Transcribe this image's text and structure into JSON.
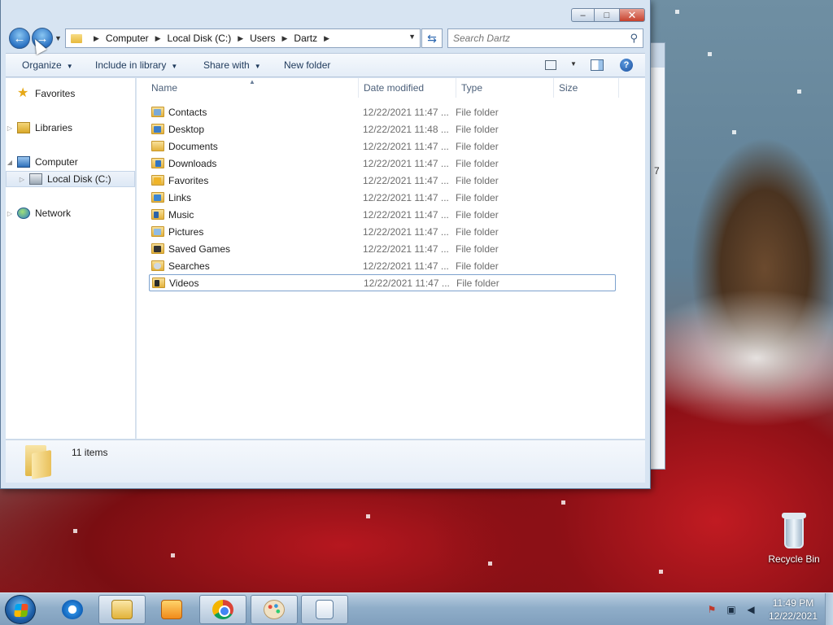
{
  "window": {
    "controls": {
      "minimize": "–",
      "maximize": "□",
      "close": "✕"
    }
  },
  "navigation": {
    "back_glyph": "←",
    "forward_glyph": "→",
    "breadcrumb": [
      "Computer",
      "Local Disk (C:)",
      "Users",
      "Dartz"
    ],
    "search_placeholder": "Search Dartz"
  },
  "command_bar": {
    "organize": "Organize",
    "include_in_library": "Include in library",
    "share_with": "Share with",
    "new_folder": "New folder",
    "help": "?"
  },
  "nav_pane": {
    "favorites": "Favorites",
    "libraries": "Libraries",
    "computer": "Computer",
    "local_disk": "Local Disk (C:)",
    "network": "Network"
  },
  "file_list": {
    "columns": {
      "name": "Name",
      "date_modified": "Date modified",
      "type": "Type",
      "size": "Size"
    },
    "rows": [
      {
        "name": "Contacts",
        "date": "12/22/2021 11:47 ...",
        "type": "File folder"
      },
      {
        "name": "Desktop",
        "date": "12/22/2021 11:48 ...",
        "type": "File folder"
      },
      {
        "name": "Documents",
        "date": "12/22/2021 11:47 ...",
        "type": "File folder"
      },
      {
        "name": "Downloads",
        "date": "12/22/2021 11:47 ...",
        "type": "File folder"
      },
      {
        "name": "Favorites",
        "date": "12/22/2021 11:47 ...",
        "type": "File folder"
      },
      {
        "name": "Links",
        "date": "12/22/2021 11:47 ...",
        "type": "File folder"
      },
      {
        "name": "Music",
        "date": "12/22/2021 11:47 ...",
        "type": "File folder"
      },
      {
        "name": "Pictures",
        "date": "12/22/2021 11:47 ...",
        "type": "File folder"
      },
      {
        "name": "Saved Games",
        "date": "12/22/2021 11:47 ...",
        "type": "File folder"
      },
      {
        "name": "Searches",
        "date": "12/22/2021 11:47 ...",
        "type": "File folder"
      },
      {
        "name": "Videos",
        "date": "12/22/2021 11:47 ...",
        "type": "File folder"
      }
    ]
  },
  "details_pane": {
    "item_count": "11 items"
  },
  "desktop": {
    "recycle_bin": "Recycle Bin",
    "background_window_char": "7"
  },
  "taskbar": {
    "time": "11:49 PM",
    "date": "12/22/2021",
    "pinned": [
      "internet-explorer-icon",
      "windows-explorer-icon",
      "media-player-icon",
      "chrome-icon",
      "paint-icon",
      "wordpad-icon"
    ]
  }
}
